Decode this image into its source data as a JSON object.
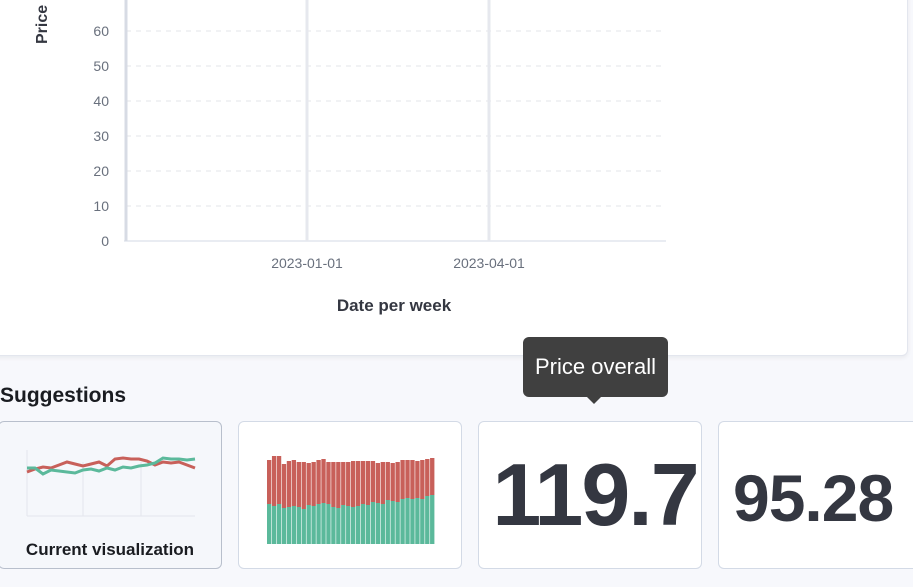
{
  "chart_data": {
    "type": "line",
    "xlabel": "Date per week",
    "ylabel": "Price",
    "y_ticks": [
      "0",
      "10",
      "20",
      "30",
      "40",
      "50",
      "60"
    ],
    "x_ticks": [
      "2023-01-01",
      "2023-04-01"
    ],
    "ylim": [
      0,
      60
    ],
    "grid": "dashed horizontal",
    "series": []
  },
  "suggestions": {
    "title": "Suggestions",
    "cards": [
      {
        "label": "Current visualization",
        "kind": "line-thumbnail"
      },
      {
        "label": "",
        "kind": "stacked-bar-thumbnail"
      },
      {
        "value": "119.7",
        "kind": "metric"
      },
      {
        "value": "95.28",
        "kind": "metric"
      }
    ]
  },
  "tooltip": {
    "text": "Price overall"
  },
  "colors": {
    "series_red": "#c8605a",
    "series_green": "#5bb99b",
    "text_dark": "#343741",
    "tooltip_bg": "#404040"
  }
}
